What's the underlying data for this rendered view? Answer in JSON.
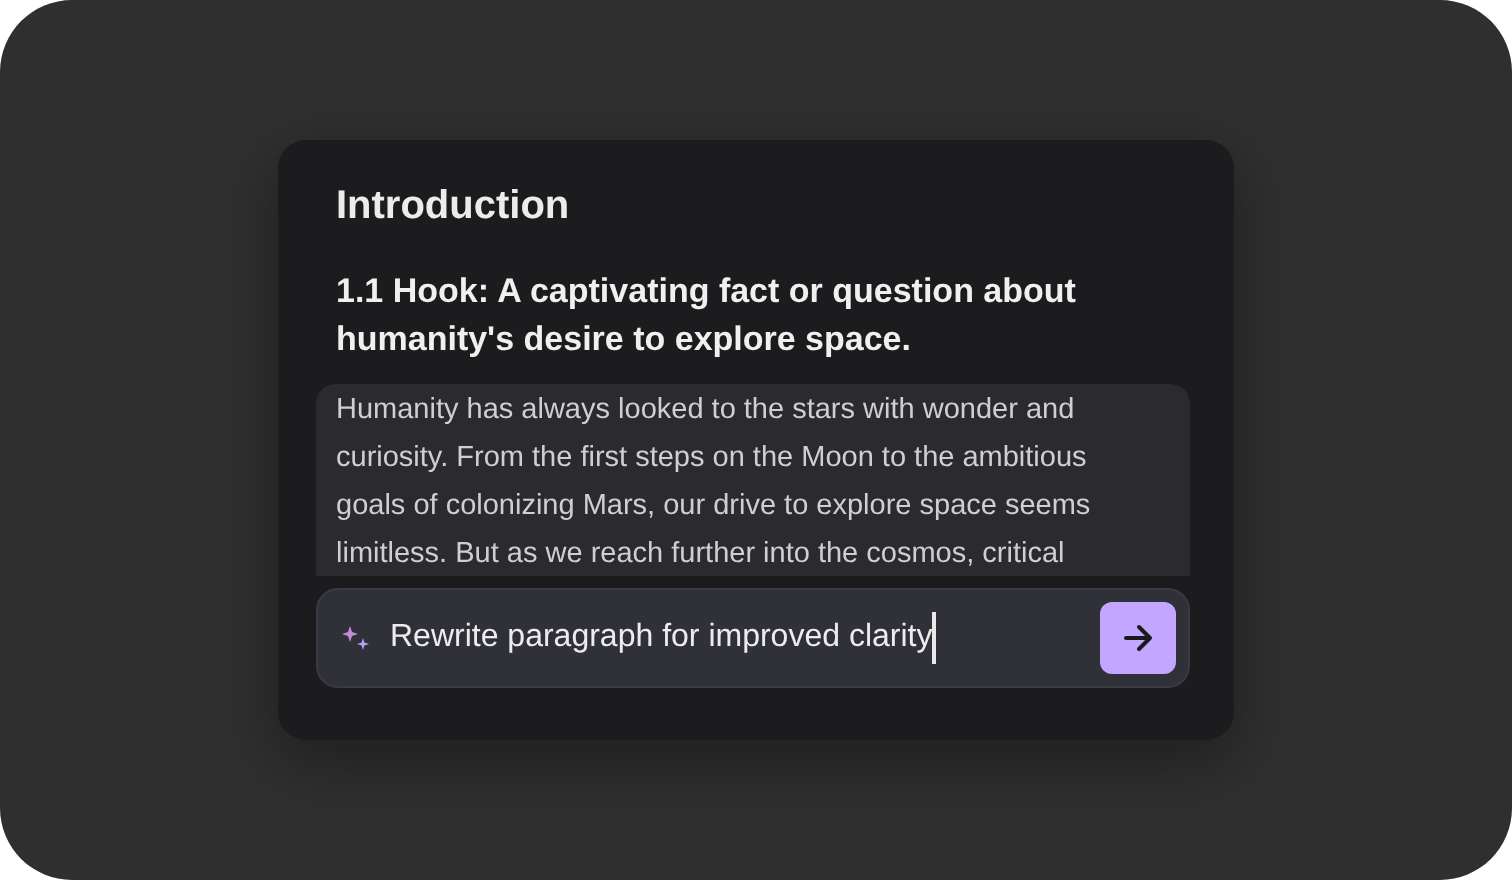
{
  "card": {
    "title": "Introduction",
    "heading": "1.1 Hook: A captivating fact or question about humanity's desire to explore space.",
    "paragraph": {
      "text": "Humanity has always looked to the stars with wonder and curiosity. From the first steps on the Moon to the ambitious goals of colonizing Mars, our drive to explore space seems limitless. But as we reach further into the cosmos, critical",
      "selected": true
    },
    "prompt": {
      "value": "Rewrite paragraph for improved clarity",
      "focused": true
    }
  }
}
